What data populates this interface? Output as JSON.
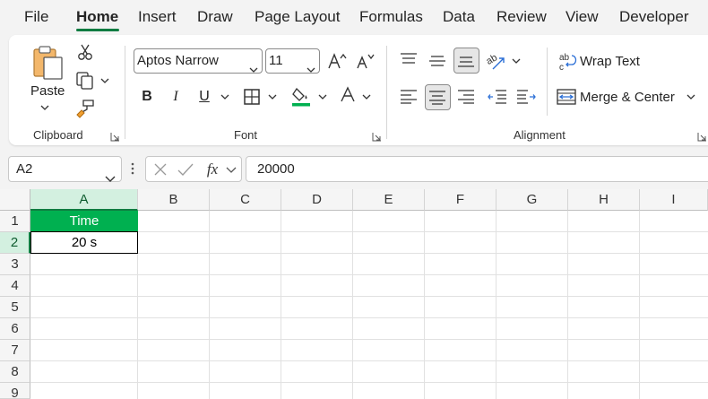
{
  "menu": {
    "tabs": [
      {
        "label": "File"
      },
      {
        "label": "Home"
      },
      {
        "label": "Insert"
      },
      {
        "label": "Draw"
      },
      {
        "label": "Page Layout"
      },
      {
        "label": "Formulas"
      },
      {
        "label": "Data"
      },
      {
        "label": "Review"
      },
      {
        "label": "View"
      },
      {
        "label": "Developer"
      }
    ],
    "active": "Home"
  },
  "ribbon": {
    "clipboard": {
      "label": "Clipboard",
      "paste_label": "Paste"
    },
    "font": {
      "label": "Font",
      "font_name": "Aptos Narrow",
      "font_size": "11",
      "color_underline": "#00b050"
    },
    "alignment": {
      "label": "Alignment",
      "wrap_text_label": "Wrap Text",
      "merge_center_label": "Merge & Center"
    }
  },
  "formula_bar": {
    "name_box": "A2",
    "formula": "20000"
  },
  "sheet": {
    "columns": [
      "A",
      "B",
      "C",
      "D",
      "E",
      "F",
      "G",
      "H",
      "I"
    ],
    "rows": [
      "1",
      "2",
      "3",
      "4",
      "5",
      "6",
      "7",
      "8",
      "9"
    ],
    "selected_column": "A",
    "selected_row": "2",
    "cells": {
      "A1": {
        "value": "Time",
        "fill": "#00b050",
        "color": "#ffffff"
      },
      "A2": {
        "value": "20 s"
      }
    }
  },
  "colors": {
    "accent": "#107c41",
    "header_fill": "#00b050"
  }
}
